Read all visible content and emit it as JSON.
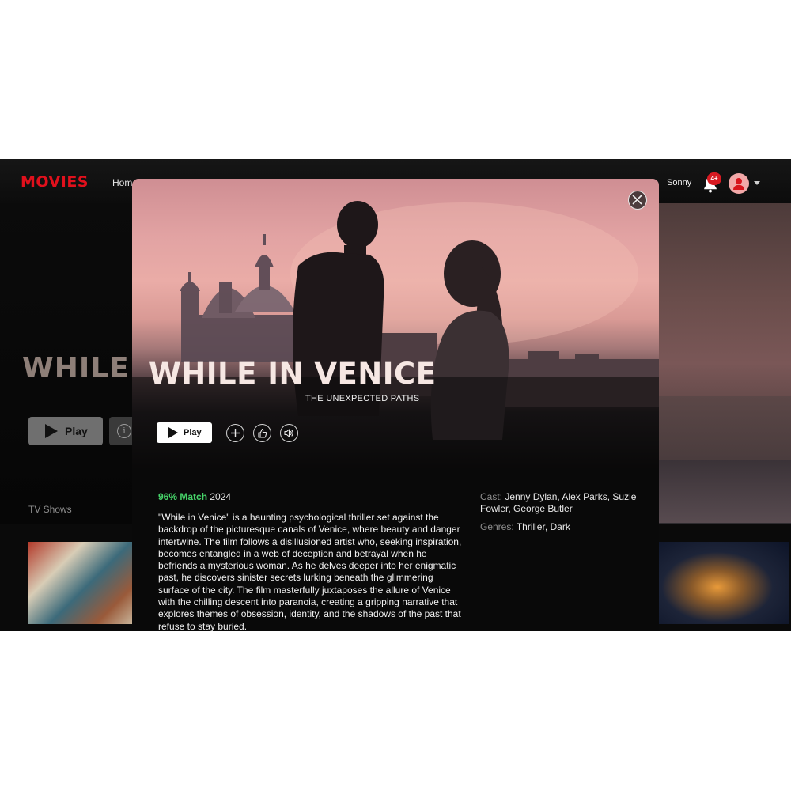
{
  "header": {
    "logo": "MOVIES",
    "nav_home": "Home",
    "username": "Sonny",
    "notifications_badge": "4+"
  },
  "background": {
    "title": "WHILE I",
    "play_label": "Play",
    "info_icon": "i",
    "section_title": "TV Shows"
  },
  "modal": {
    "title": "WHILE IN VENICE",
    "subtitle": "THE UNEXPECTED PATHS",
    "play_label": "Play",
    "match": "96% Match",
    "year": "2024",
    "description": "\"While in Venice\" is a haunting psychological thriller set against the backdrop of the picturesque canals of Venice, where beauty and danger intertwine. The film follows a disillusioned artist who, seeking inspiration, becomes entangled in a web of deception and betrayal when he befriends a mysterious woman. As he delves deeper into her enigmatic past, he discovers sinister secrets lurking beneath the glimmering surface of the city. The film masterfully juxtaposes the allure of Venice with the chilling descent into paranoia, creating a gripping narrative that explores themes of obsession, identity, and the shadows of the past that refuse to stay buried.",
    "cast_label": "Cast:",
    "cast": "Jenny Dylan, Alex Parks, Suzie Fowler, George Butler",
    "genres_label": "Genres:",
    "genres": "Thriller, Dark"
  },
  "colors": {
    "brand": "#e0101c",
    "match_green": "#46d369",
    "badge_red": "#d81a22"
  },
  "icons": [
    "bell-icon",
    "avatar-icon",
    "chevron-down-icon",
    "close-icon",
    "play-icon",
    "plus-icon",
    "thumbs-up-icon",
    "volume-icon",
    "info-icon"
  ]
}
